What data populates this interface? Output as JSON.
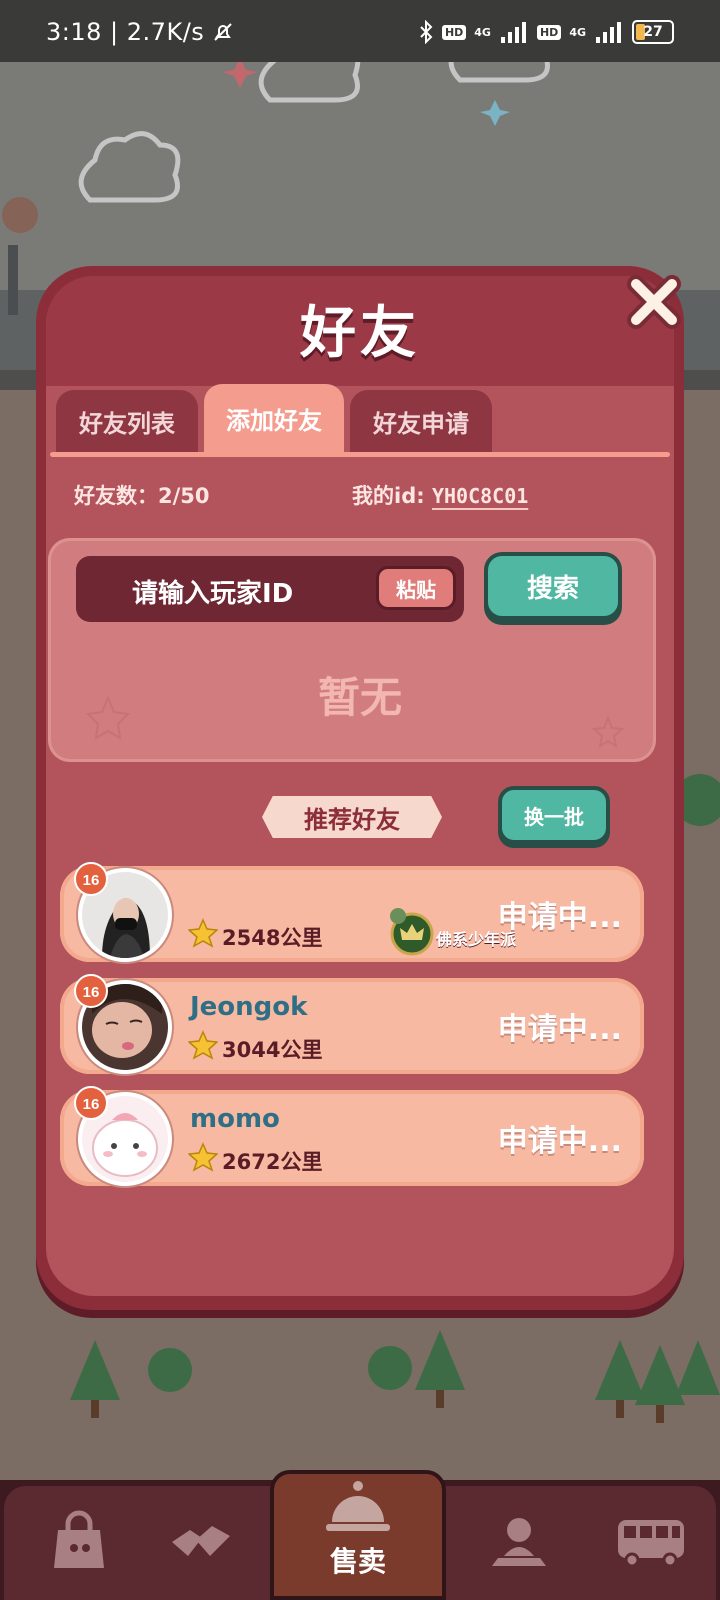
{
  "status_bar": {
    "time": "3:18",
    "net_speed": "2.7K/s",
    "separator": "|",
    "bluetooth_icon": "bluetooth-icon",
    "hd1": "HD",
    "sig1": "4G",
    "hd2": "HD",
    "sig2": "4G",
    "battery": "27"
  },
  "dialog": {
    "title": "好友",
    "close_icon": "close-icon",
    "tabs": [
      {
        "label": "好友列表",
        "active": false
      },
      {
        "label": "添加好友",
        "active": true
      },
      {
        "label": "好友申请",
        "active": false
      }
    ],
    "friend_count_label": "好友数：",
    "friend_count_value": "2/50",
    "my_id_label": "我的id:",
    "my_id_value": "YH0C8C01",
    "search": {
      "placeholder": "请输入玩家ID",
      "paste_label": "粘贴",
      "search_label": "搜索",
      "empty_text": "暂无"
    },
    "recommend": {
      "title": "推荐好友",
      "refresh_label": "换一批",
      "players": [
        {
          "level": "16",
          "name": "",
          "distance": "2548公里",
          "guild_name": "佛系少年派",
          "status": "申请中..."
        },
        {
          "level": "16",
          "name": "Jeongok",
          "distance": "3044公里",
          "guild_name": "",
          "status": "申请中..."
        },
        {
          "level": "16",
          "name": "momo",
          "distance": "2672公里",
          "guild_name": "",
          "status": "申请中..."
        }
      ]
    }
  },
  "bottom_nav": {
    "items": [
      {
        "icon": "bag-icon"
      },
      {
        "icon": "handshake-icon"
      },
      {
        "icon": "service-bell-icon",
        "label": "售卖"
      },
      {
        "icon": "map-person-icon"
      },
      {
        "icon": "bus-icon"
      }
    ]
  },
  "colors": {
    "dialog_frame": "#8c2e3a",
    "dialog_body": "#b3535c",
    "tab_active": "#f49c8e",
    "button_teal": "#4fb7a2",
    "row_bg": "#f7b9a1"
  }
}
